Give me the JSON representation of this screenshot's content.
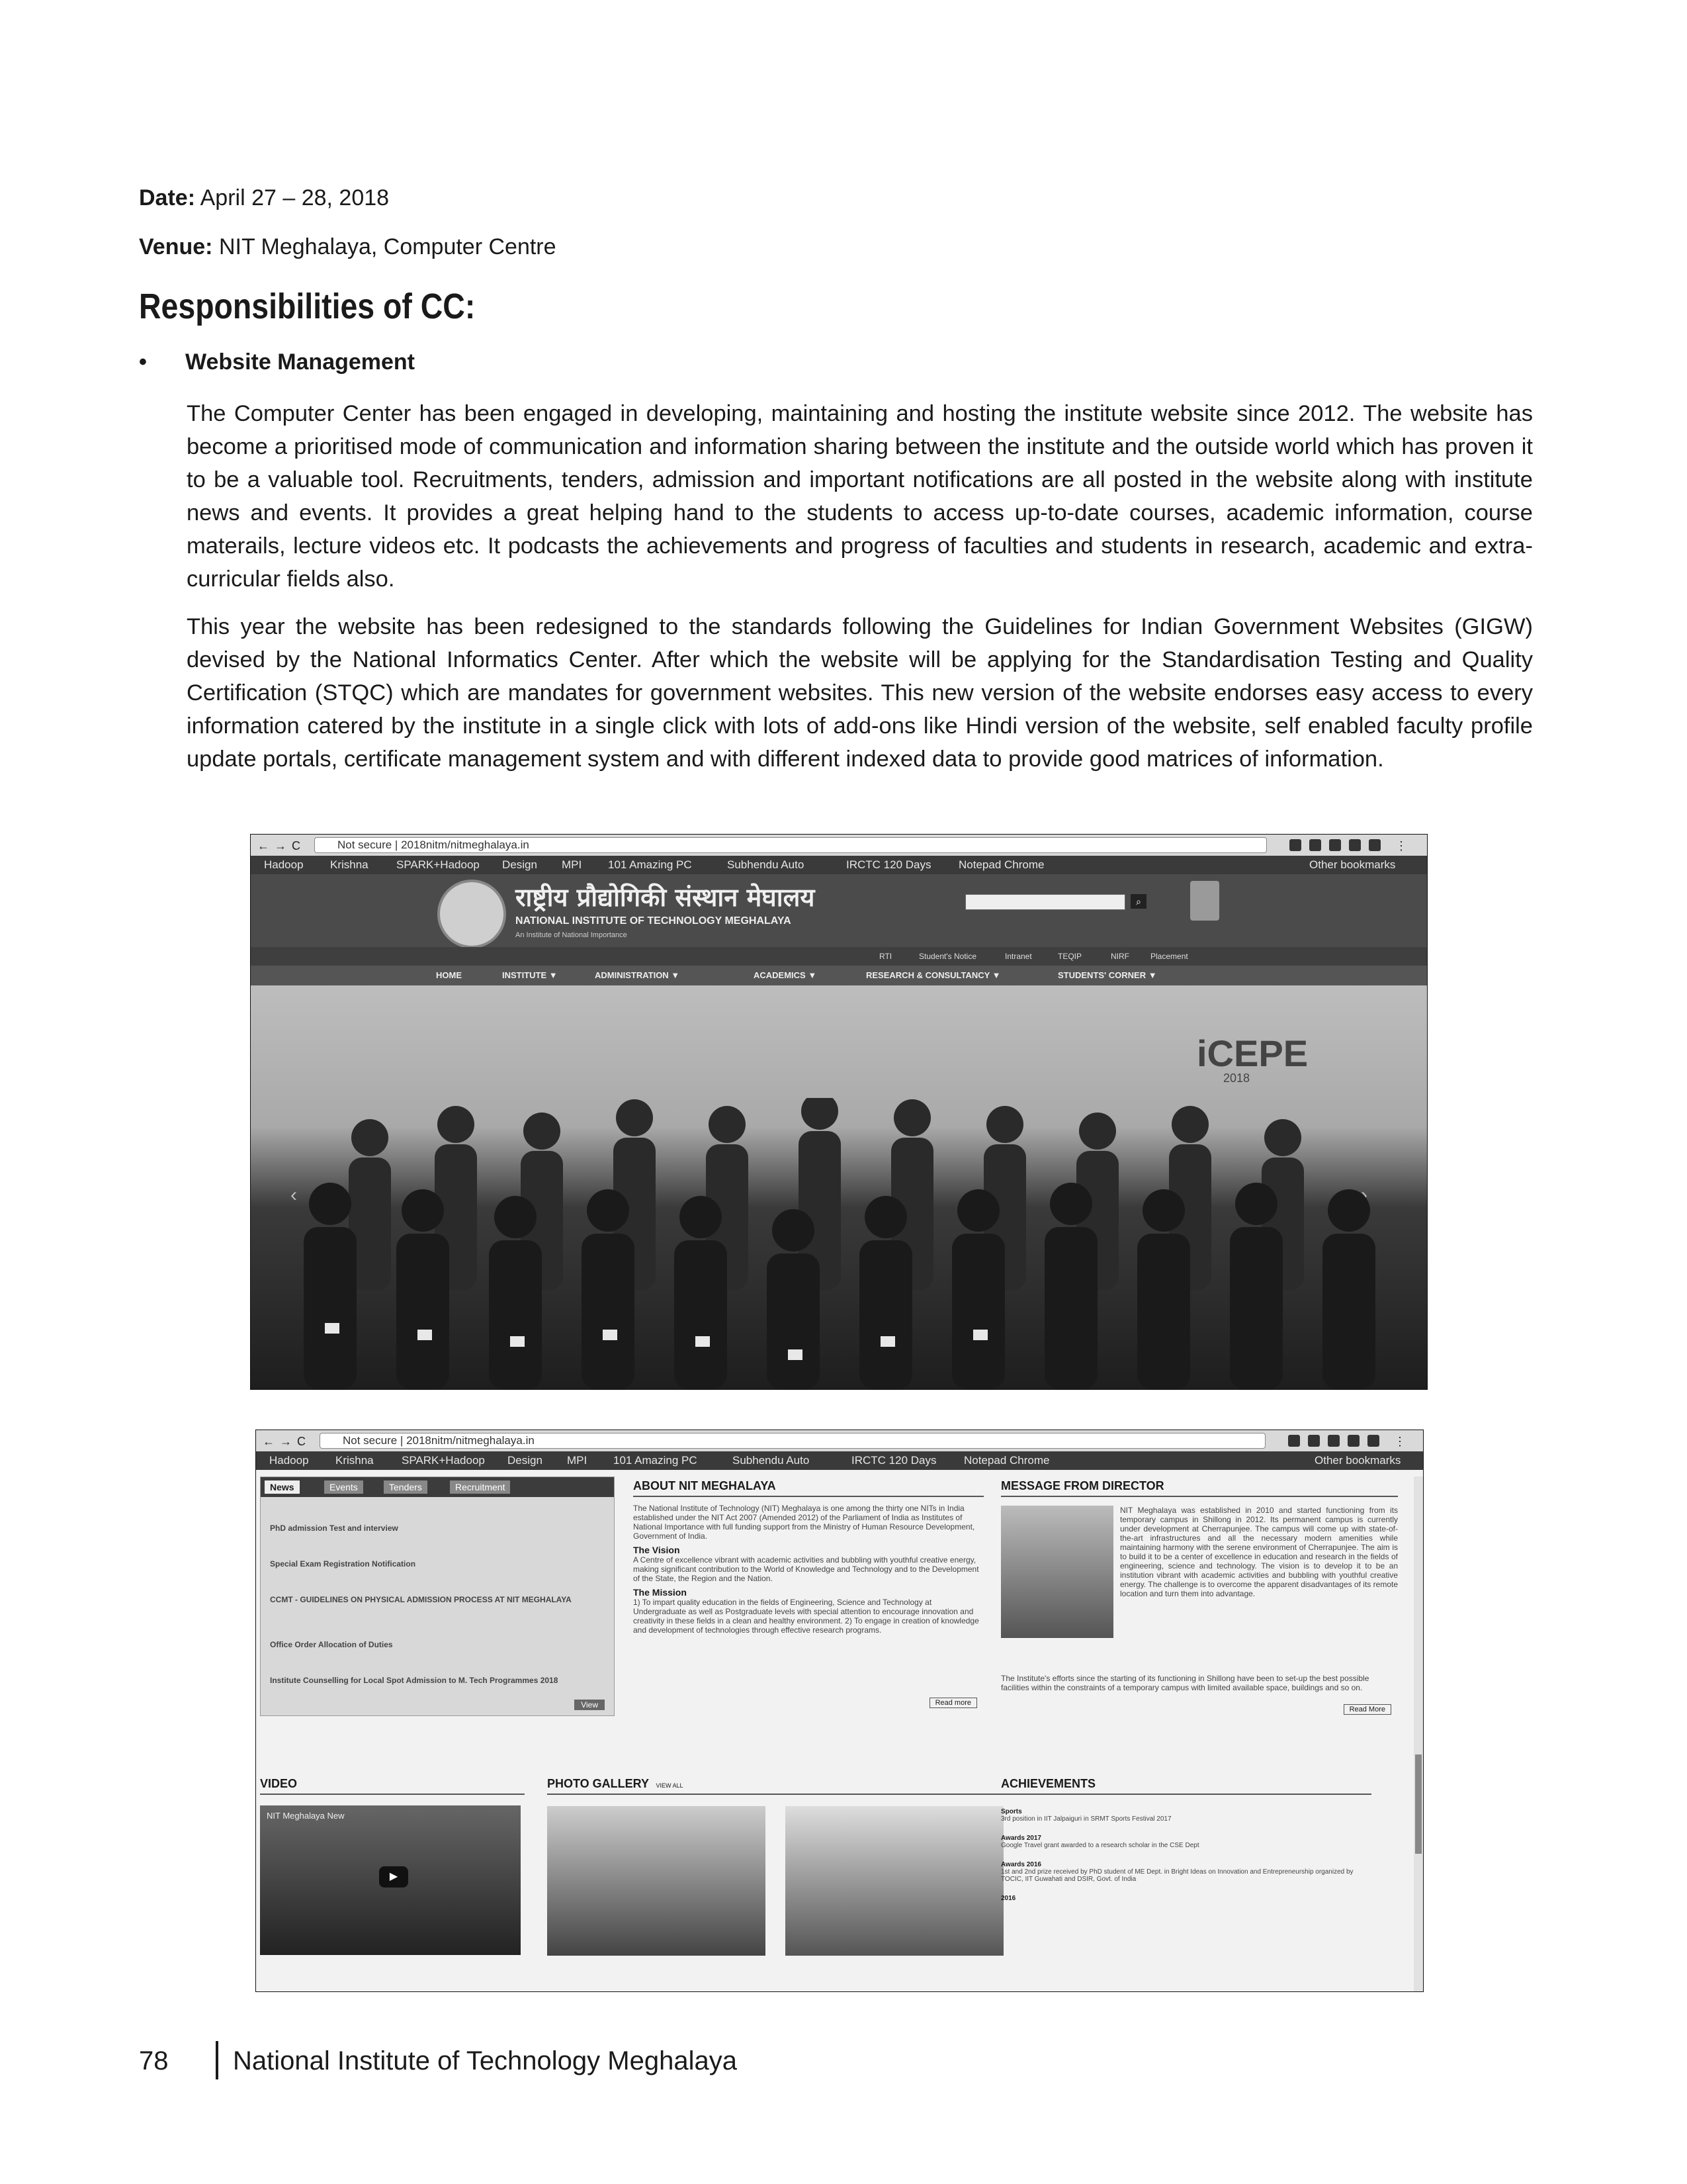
{
  "meta": {
    "date_label": "Date:",
    "date_value": "April 27 – 28, 2018",
    "venue_label": "Venue:",
    "venue_value": "NIT Meghalaya, Computer Centre"
  },
  "section_title": "Responsibilities of CC:",
  "bullet": "Website Management",
  "paragraphs": [
    "The Computer Center has been engaged in developing, maintaining and hosting the institute website since 2012. The website has become a prioritised mode of communication and information sharing between the institute and the outside world which has proven it to be a valuable tool. Recruitments, tenders, admission and important notifications are all posted in the website along with  institute news and events. It provides a great helping hand to the students to access up-to-date courses, academic information, course materails, lecture videos etc. It podcasts the achievements and progress of faculties and students in research, academic and extra-curricular fields also.",
    "This year the website has been redesigned to the standards following the Guidelines for Indian Government Websites (GIGW) devised by the National Informatics Center. After which the website will be applying for the Standardisation Testing and Quality Certification (STQC) which are mandates for government websites. This new version of the website endorses easy access to every information catered by the institute in a single click with lots of add-ons like Hindi version of the website, self enabled faculty profile update portals, certificate management system and with different indexed data to provide good matrices of information."
  ],
  "screenshot1": {
    "address": "Not secure | 2018nitm/nitmeghalaya.in",
    "bookmarks": [
      "Hadoop",
      "Krishna",
      "SPARK+Hadoop",
      "Design",
      "MPI",
      "101 Amazing PC",
      "Subhendu Auto",
      "IRCTC 120 Days",
      "Notepad Chrome",
      "Other bookmarks"
    ],
    "hindi_name": "राष्ट्रीय प्रौद्योगिकी संस्थान मेघालय",
    "english_name": "NATIONAL INSTITUTE OF TECHNOLOGY MEGHALAYA",
    "tagline": "An Institute of National Importance",
    "quick_links": [
      "RTI",
      "Student's Notice",
      "Intranet",
      "TEQIP",
      "NIRF",
      "Placement"
    ],
    "nav": [
      "HOME",
      "INSTITUTE ▼",
      "ADMINISTRATION ▼",
      "ACADEMICS ▼",
      "RESEARCH & CONSULTANCY ▼",
      "STUDENTS' CORNER ▼"
    ],
    "banner_text": "iCEPE",
    "banner_year": "2018"
  },
  "screenshot2": {
    "address": "Not secure | 2018nitm/nitmeghalaya.in",
    "bookmarks": [
      "Hadoop",
      "Krishna",
      "SPARK+Hadoop",
      "Design",
      "MPI",
      "101 Amazing PC",
      "Subhendu Auto",
      "IRCTC 120 Days",
      "Notepad Chrome",
      "Other bookmarks"
    ],
    "tabs": [
      "News",
      "Events",
      "Tenders",
      "Recruitment"
    ],
    "news_items": [
      "PhD admission Test and interview",
      "Special Exam Registration Notification",
      "CCMT - GUIDELINES ON PHYSICAL ADMISSION PROCESS AT NIT MEGHALAYA",
      "Office Order Allocation of Duties",
      "Institute Counselling for Local Spot Admission to M. Tech Programmes 2018"
    ],
    "view_all": "View",
    "about_title": "ABOUT NIT MEGHALAYA",
    "about_text": "The National Institute of Technology (NIT) Meghalaya is one among the thirty one NITs in India established under the NIT Act 2007 (Amended 2012) of the Parliament of India as Institutes of National Importance with full funding support from the Ministry of Human Resource Development, Government of India.",
    "vision_title": "The Vision",
    "vision_text": "A Centre of excellence vibrant with academic activities and bubbling with youthful creative energy, making significant contribution to the World of Knowledge and Technology and to the Development of the State, the Region and the Nation.",
    "mission_title": "The Mission",
    "mission_text": "1) To impart quality education in the fields of Engineering, Science and Technology at Undergraduate as well as Postgraduate levels with special attention to encourage innovation and creativity in these fields in a clean and healthy environment. 2) To engage in creation of knowledge and development of technologies through effective research programs.",
    "read_more": "Read more",
    "director_title": "MESSAGE FROM DIRECTOR",
    "director_text": "NIT Meghalaya was established in 2010 and started functioning from its temporary campus in Shillong in 2012. Its permanent campus is currently under development at Cherrapunjee. The campus will come up with state-of-the-art infrastructures and all the necessary modern amenities while maintaining harmony with the serene environment of Cherrapunjee. The aim is to build it to be a center of excellence in education and research in the fields of engineering, science and technology. The vision is to develop it to be an institution vibrant with academic activities and bubbling with youthful creative energy. The challenge is to overcome the apparent disadvantages of its remote location and turn them into advantage.",
    "director_text2": "The Institute's efforts since the starting of its functioning in Shillong have been to set-up the best possible facilities within the constraints of a temporary campus with limited available space, buildings and so on.",
    "read_more2": "Read More",
    "video_title": "VIDEO",
    "video_caption": "NIT Meghalaya New",
    "gallery_title": "PHOTO GALLERY",
    "gallery_viewall": "VIEW ALL",
    "achievements_title": "ACHIEVEMENTS",
    "achievements": [
      {
        "head": "Sports",
        "text": "3rd position in IIT Jalpaiguri in SRMT Sports Festival 2017"
      },
      {
        "head": "Awards 2017",
        "text": "Google Travel grant awarded to a research scholar in the CSE Dept"
      },
      {
        "head": "Awards 2016",
        "text": "1st and 2nd prize received by PhD student of ME Dept. in Bright Ideas on Innovation and Entrepreneurship organized by TOCIC, IIT Guwahati and DSIR, Govt. of India"
      },
      {
        "head": "2016",
        "text": ""
      }
    ]
  },
  "footer": {
    "page_number": "78",
    "title": "National Institute of Technology Meghalaya"
  }
}
